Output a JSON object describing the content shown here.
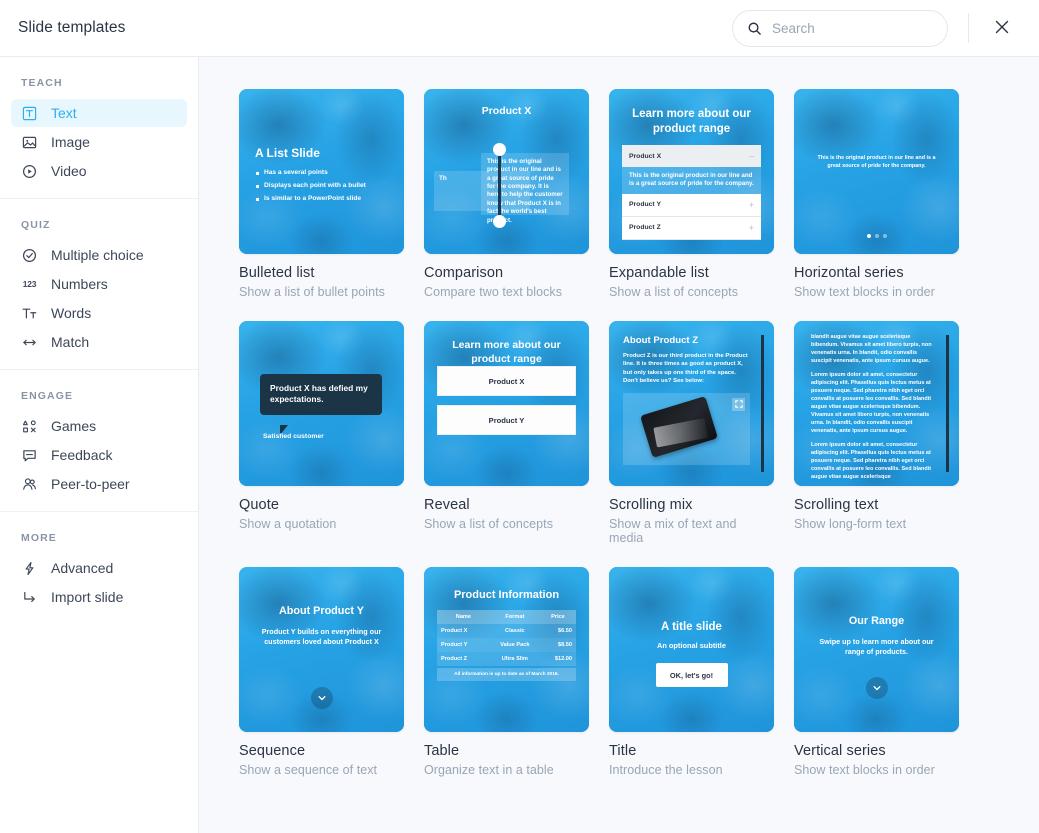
{
  "header": {
    "title": "Slide templates",
    "search_placeholder": "Search",
    "search_value": "",
    "search_icon": "search-icon",
    "close_icon": "close-icon"
  },
  "sidebar": {
    "groups": [
      {
        "label": "TEACH",
        "items": [
          {
            "label": "Text",
            "icon": "text-box-icon",
            "active": true
          },
          {
            "label": "Image",
            "icon": "image-icon",
            "active": false
          },
          {
            "label": "Video",
            "icon": "play-circle-icon",
            "active": false
          }
        ]
      },
      {
        "label": "QUIZ",
        "items": [
          {
            "label": "Multiple choice",
            "icon": "check-circle-icon",
            "active": false
          },
          {
            "label": "Numbers",
            "icon": "numbers-123-icon",
            "active": false
          },
          {
            "label": "Words",
            "icon": "text-format-icon",
            "active": false
          },
          {
            "label": "Match",
            "icon": "arrows-horizontal-icon",
            "active": false
          }
        ]
      },
      {
        "label": "ENGAGE",
        "items": [
          {
            "label": "Games",
            "icon": "game-shapes-icon",
            "active": false
          },
          {
            "label": "Feedback",
            "icon": "comment-icon",
            "active": false
          },
          {
            "label": "Peer-to-peer",
            "icon": "people-icon",
            "active": false
          }
        ]
      },
      {
        "label": "MORE",
        "items": [
          {
            "label": "Advanced",
            "icon": "lightning-icon",
            "active": false
          },
          {
            "label": "Import slide",
            "icon": "arrow-import-icon",
            "active": false
          }
        ]
      }
    ]
  },
  "templates": {
    "bulleted_list": {
      "name": "Bulleted list",
      "desc": "Show a list of bullet points",
      "slide_title": "A List Slide",
      "bullets": [
        "Has a several points",
        "Displays each point with a bullet",
        "Is similar to a PowerPoint slide"
      ]
    },
    "comparison": {
      "name": "Comparison",
      "desc": "Compare two text blocks",
      "slide_title": "Product X",
      "left_text": "Th",
      "right_text": "This is the original product in our line and is a great source of pride for the company. It is here to help the customer know that Product X is in fact the world's best product."
    },
    "expandable_list": {
      "name": "Expandable list",
      "desc": "Show a list of concepts",
      "slide_title": "Learn more about our product range",
      "open_item": "Product X",
      "open_body": "This is the original product in our line and is a great source of pride for the company.",
      "collapsed_items": [
        "Product Y",
        "Product Z"
      ],
      "minus_sign": "–",
      "plus_sign": "+"
    },
    "horizontal_series": {
      "name": "Horizontal series",
      "desc": "Show text blocks in order",
      "body": "This is the original product in our line and is a great source of pride for the company.",
      "dots": 3,
      "active_dot": 1
    },
    "quote": {
      "name": "Quote",
      "desc": "Show a quotation",
      "quote": "Product X has defied my expectations.",
      "author": "Satisfied customer"
    },
    "reveal": {
      "name": "Reveal",
      "desc": "Show a list of concepts",
      "slide_title": "Learn more about our product range",
      "buttons": [
        "Product X",
        "Product Y"
      ]
    },
    "scrolling_mix": {
      "name": "Scrolling mix",
      "desc": "Show a mix of text and media",
      "slide_title": "About Product Z",
      "body": "Product Z is our third product in the Product line. It is three times as good as product X, but only takes up one third of the space. Don't believe us? See below:",
      "fullscreen_icon": "fullscreen-icon"
    },
    "scrolling_text": {
      "name": "Scrolling text",
      "desc": "Show long-form text",
      "paragraphs": [
        "blandit augue vitae augue scelerisque bibendum. Vivamus sit amet libero turpis, non venenatis urna. In blandit, odio convallis suscipit venenatis, ante ipsum cursus augue.",
        "Lorem ipsum dolor sit amet, consectetur adipiscing elit. Phasellus quis lectus metus at posuere neque. Sed pharetra nibh eget orci convallis at posuere leo convallis. Sed blandit augue vitae augue scelerisque bibendum. Vivamus sit amet libero turpis, non venenatis urna. In blandit, odio convallis suscipit venenatis, ante ipsum cursus augue.",
        "Lorem ipsum dolor sit amet, consectetur adipiscing elit. Phasellus quis lectus metus at posuere neque. Sed pharetra nibh eget orci convallis at posuere leo convallis. Sed blandit augue vitae augue scelerisque"
      ]
    },
    "sequence": {
      "name": "Sequence",
      "desc": "Show a sequence of text",
      "slide_title": "About Product Y",
      "subtitle": "Product Y builds on everything our customers loved about Product X",
      "chevron_icon": "chevron-down-icon"
    },
    "table": {
      "name": "Table",
      "desc": "Organize text in a table",
      "slide_title": "Product Information",
      "columns": [
        "Name",
        "Format",
        "Price"
      ],
      "rows": [
        [
          "Product X",
          "Classic",
          "$6.50"
        ],
        [
          "Product Y",
          "Value Pack",
          "$8.50"
        ],
        [
          "Product Z",
          "Ultra Slim",
          "$12.00"
        ]
      ],
      "footer": "All information is up to date as of March 2016."
    },
    "title": {
      "name": "Title",
      "desc": "Introduce the lesson",
      "slide_title": "A title slide",
      "subtitle": "An optional subtitle",
      "button": "OK, let's go!"
    },
    "vertical_series": {
      "name": "Vertical series",
      "desc": "Show text blocks in order",
      "slide_title": "Our Range",
      "subtitle": "Swipe up to learn more about our range of products.",
      "chevron_icon": "chevron-down-icon"
    }
  },
  "colors": {
    "accent": "#2bb0f0",
    "slide_blue": "#29a8e8",
    "dark": "#1b3446",
    "content_bg": "#f7f9fc"
  }
}
